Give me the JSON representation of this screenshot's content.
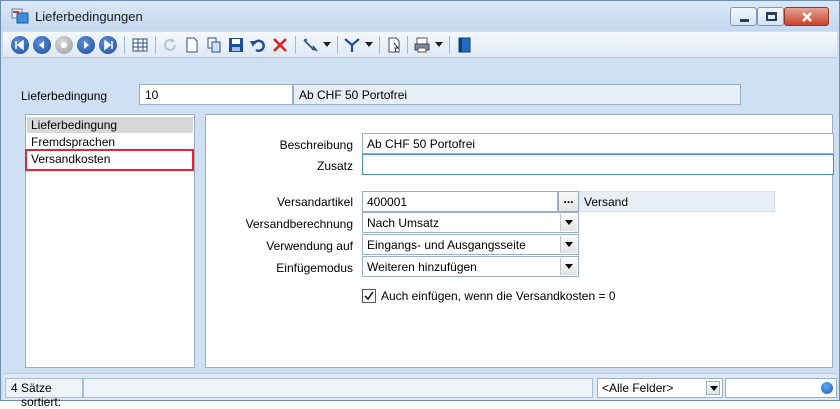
{
  "window": {
    "title": "Lieferbedingungen",
    "accent": "#1d4f9e",
    "highlight_color": "#e02633"
  },
  "toolbar": {
    "icons": [
      "first-record-icon",
      "prev-record-icon",
      "disabled-record-icon",
      "next-record-icon",
      "last-record-icon",
      "table-view-icon",
      "refresh-icon",
      "new-icon",
      "copy-icon",
      "save-icon",
      "undo-icon",
      "delete-icon",
      "pen-icon",
      "filter-icon",
      "import-icon",
      "print-icon",
      "book-icon"
    ]
  },
  "header": {
    "label": "Lieferbedingung",
    "code": "10",
    "description": "Ab CHF 50 Portofrei"
  },
  "nav": {
    "items": [
      {
        "label": "Lieferbedingung",
        "selected": true
      },
      {
        "label": "Fremdsprachen",
        "selected": false
      },
      {
        "label": "Versandkosten",
        "selected": false
      }
    ]
  },
  "form": {
    "beschreibung_label": "Beschreibung",
    "beschreibung_value": "Ab CHF 50 Portofrei",
    "zusatz_label": "Zusatz",
    "zusatz_value": "",
    "versandartikel_label": "Versandartikel",
    "versandartikel_value": "400001",
    "versandartikel_lookup": "Versand",
    "ellipsis": "...",
    "versandberechnung_label": "Versandberechnung",
    "versandberechnung_value": "Nach Umsatz",
    "verwendung_label": "Verwendung auf",
    "verwendung_value": "Eingangs- und Ausgangsseite",
    "einfuegemodus_label": "Einfügemodus",
    "einfuegemodus_value": "Weiteren hinzufügen",
    "checkbox_label": "Auch einfügen, wenn die Versandkosten = 0",
    "checkbox_checked": true
  },
  "status": {
    "count": "4 Sätze",
    "sort": "sortiert:",
    "field_filter": "<Alle Felder>"
  }
}
